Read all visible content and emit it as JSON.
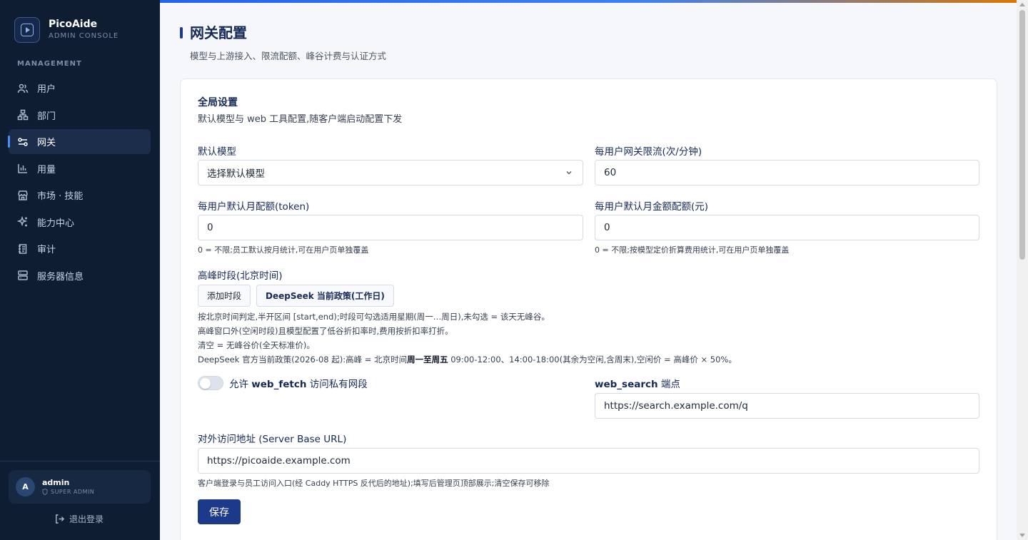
{
  "brand": {
    "name": "PicoAide",
    "subtitle": "ADMIN CONSOLE"
  },
  "sidebar": {
    "section_label": "MANAGEMENT",
    "items": [
      {
        "label": "用户",
        "icon": "users-icon"
      },
      {
        "label": "部门",
        "icon": "org-tree-icon"
      },
      {
        "label": "网关",
        "icon": "gateway-sliders-icon",
        "active": true
      },
      {
        "label": "用量",
        "icon": "bar-chart-icon"
      },
      {
        "label": "市场 · 技能",
        "icon": "store-icon"
      },
      {
        "label": "能力中心",
        "icon": "sparkle-icon"
      },
      {
        "label": "审计",
        "icon": "audit-log-icon"
      },
      {
        "label": "服务器信息",
        "icon": "server-icon"
      }
    ],
    "user": {
      "avatar": "A",
      "name": "admin",
      "role": "SUPER ADMIN"
    },
    "logout": "退出登录"
  },
  "page": {
    "title": "网关配置",
    "subtitle": "模型与上游接入、限流配额、峰谷计费与认证方式"
  },
  "card": {
    "title": "全局设置",
    "description": "默认模型与 web 工具配置,随客户端启动配置下发",
    "default_model": {
      "label": "默认模型",
      "value": "选择默认模型"
    },
    "rate_limit": {
      "label": "每用户网关限流(次/分钟)",
      "value": "60"
    },
    "monthly_token_quota": {
      "label": "每用户默认月配额(token)",
      "value": "0",
      "hint": "0 = 不限;员工默认按月统计,可在用户页单独覆盖"
    },
    "monthly_amount_quota": {
      "label": "每用户默认月金额配额(元)",
      "value": "0",
      "hint": "0 = 不限;按模型定价折算费用统计,可在用户页单独覆盖"
    },
    "peak": {
      "label": "高峰时段(北京时间)",
      "add_button": "添加时段",
      "policy_button": "DeepSeek 当前政策(工作日)",
      "line1": "按北京时间判定,半开区间 [start,end);时段可勾选适用星期(周一…周日),未勾选 = 该天无峰谷。",
      "line2": "高峰窗口外(空闲时段)且模型配置了低谷折扣率时,费用按折扣率打折。",
      "line3": "清空 = 无峰谷价(全天标准价)。",
      "line4_prefix": "DeepSeek 官方当前政策(2026-08 起):高峰 = 北京时间",
      "line4_bold": "周一至周五",
      "line4_suffix": " 09:00-12:00、14:00-18:00(其余为空闲,含周末),空闲价 = 高峰价 × 50%。"
    },
    "web_fetch": {
      "label_prefix": "允许 ",
      "label_bold": "web_fetch",
      "label_suffix": " 访问私有网段",
      "enabled": false
    },
    "web_search": {
      "label_bold": "web_search",
      "label_suffix": " 端点",
      "value": "https://search.example.com/q"
    },
    "server_url": {
      "label": "对外访问地址 (Server Base URL)",
      "value": "https://picoaide.example.com",
      "hint": "客户端登录与员工访问入口(经 Caddy HTTPS 反代后的地址);填写后管理页顶部展示;清空保存可移除"
    },
    "save_button": "保存"
  },
  "colors": {
    "sidebar_bg": "#0f1d33",
    "primary": "#1d3a8a",
    "accent": "#4f8cf5"
  }
}
